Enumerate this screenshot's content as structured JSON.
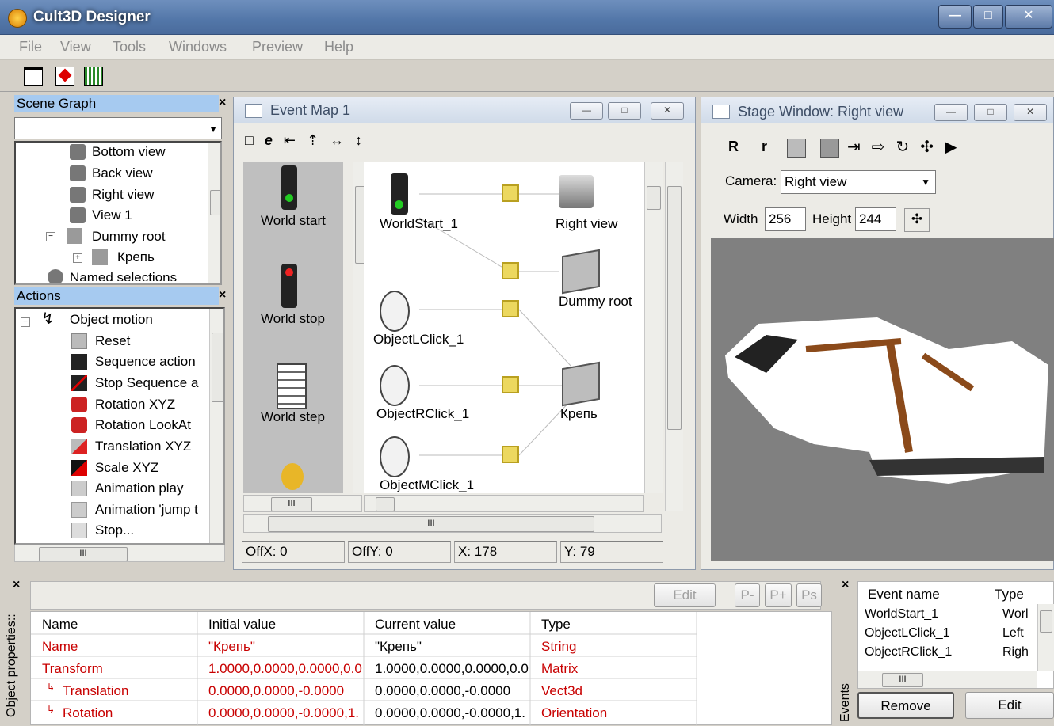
{
  "app": {
    "title": "Cult3D Designer"
  },
  "menu": [
    "File",
    "View",
    "Tools",
    "Windows",
    "Preview",
    "Help"
  ],
  "scene_graph": {
    "title": "Scene Graph",
    "items": [
      "Bottom view",
      "Back view",
      "Right view",
      "View 1",
      "Dummy root",
      "Крепь",
      "Named selections"
    ]
  },
  "actions": {
    "title": "Actions",
    "root": "Object motion",
    "items": [
      "Reset",
      "Sequence action",
      "Stop Sequence a",
      "Rotation XYZ",
      "Rotation LookAt",
      "Translation XYZ",
      "Scale XYZ",
      "Animation play",
      "Animation 'jump t",
      "Stop..."
    ],
    "scroll_label": "III"
  },
  "event_map": {
    "title": "Event Map 1",
    "palette": [
      "World start",
      "World stop",
      "World step"
    ],
    "nodes": [
      "WorldStart_1",
      "Right view",
      "Dummy root",
      "ObjectLClick_1",
      "ObjectRClick_1",
      "Крепь",
      "ObjectMClick_1"
    ],
    "scroll_label": "III",
    "status": {
      "offx": "OffX: 0",
      "offy": "OffY: 0",
      "x": "X: 178",
      "y": "Y: 79"
    }
  },
  "stage": {
    "title": "Stage Window: Right view",
    "tools": [
      "R",
      "r"
    ],
    "camera_label": "Camera:",
    "camera_value": "Right view",
    "width_label": "Width",
    "width_value": "256",
    "height_label": "Height",
    "height_value": "244"
  },
  "object_properties": {
    "side_label": "Object properties::",
    "buttons": [
      "Edit",
      "P-",
      "P+",
      "Ps"
    ],
    "columns": [
      "Name",
      "Initial value",
      "Current value",
      "Type"
    ],
    "rows": [
      [
        "Name",
        "\"Крепь\"",
        "\"Крепь\"",
        "String"
      ],
      [
        "Transform",
        "1.0000,0.0000,0.0000,0.0",
        "1.0000,0.0000,0.0000,0.0",
        "Matrix"
      ],
      [
        "Translation",
        "0.0000,0.0000,-0.0000",
        "0.0000,0.0000,-0.0000",
        "Vect3d"
      ],
      [
        "Rotation",
        "0.0000,0.0000,-0.0000,1.",
        "0.0000,0.0000,-0.0000,1.",
        "Orientation"
      ]
    ]
  },
  "events": {
    "side_label": "Events",
    "columns": [
      "Event name",
      "Type"
    ],
    "rows": [
      [
        "WorldStart_1",
        "Worl"
      ],
      [
        "ObjectLClick_1",
        "Left"
      ],
      [
        "ObjectRClick_1",
        "Righ"
      ]
    ],
    "scroll_label": "III",
    "remove": "Remove",
    "edit": "Edit"
  }
}
